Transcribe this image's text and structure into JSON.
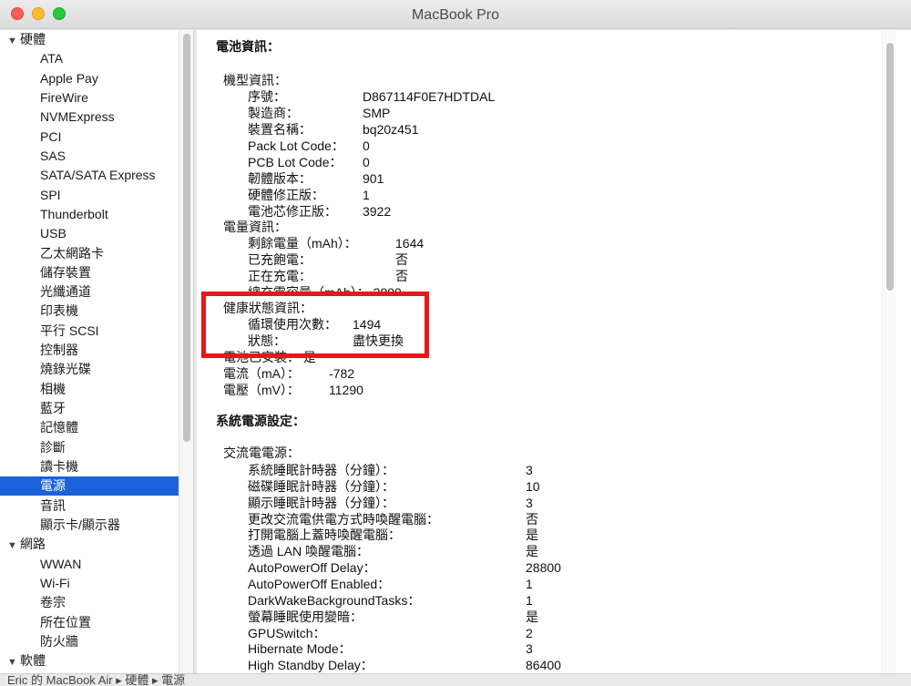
{
  "window": {
    "title": "MacBook Pro"
  },
  "sidebar": {
    "items": [
      {
        "type": "category",
        "label": "硬體"
      },
      {
        "type": "child",
        "label": "ATA"
      },
      {
        "type": "child",
        "label": "Apple Pay"
      },
      {
        "type": "child",
        "label": "FireWire"
      },
      {
        "type": "child",
        "label": "NVMExpress"
      },
      {
        "type": "child",
        "label": "PCI"
      },
      {
        "type": "child",
        "label": "SAS"
      },
      {
        "type": "child",
        "label": "SATA/SATA Express"
      },
      {
        "type": "child",
        "label": "SPI"
      },
      {
        "type": "child",
        "label": "Thunderbolt"
      },
      {
        "type": "child",
        "label": "USB"
      },
      {
        "type": "child",
        "label": "乙太網路卡"
      },
      {
        "type": "child",
        "label": "儲存裝置"
      },
      {
        "type": "child",
        "label": "光纖通道"
      },
      {
        "type": "child",
        "label": "印表機"
      },
      {
        "type": "child",
        "label": "平行 SCSI"
      },
      {
        "type": "child",
        "label": "控制器"
      },
      {
        "type": "child",
        "label": "燒錄光碟"
      },
      {
        "type": "child",
        "label": "相機"
      },
      {
        "type": "child",
        "label": "藍牙"
      },
      {
        "type": "child",
        "label": "記憶體"
      },
      {
        "type": "child",
        "label": "診斷"
      },
      {
        "type": "child",
        "label": "讀卡機"
      },
      {
        "type": "child",
        "label": "電源",
        "selected": true
      },
      {
        "type": "child",
        "label": "音訊"
      },
      {
        "type": "child",
        "label": "顯示卡/顯示器"
      },
      {
        "type": "category",
        "label": "網路"
      },
      {
        "type": "child",
        "label": "WWAN"
      },
      {
        "type": "child",
        "label": "Wi-Fi"
      },
      {
        "type": "child",
        "label": "卷宗"
      },
      {
        "type": "child",
        "label": "所在位置"
      },
      {
        "type": "child",
        "label": "防火牆"
      },
      {
        "type": "category",
        "label": "軟體"
      }
    ]
  },
  "content": {
    "battery_header": "電池資訊：",
    "model_info": "機型資訊：",
    "serial_label": "序號：",
    "serial_value": "D867114F0E7HDTDAL",
    "manufacturer_label": "製造商：",
    "manufacturer_value": "SMP",
    "device_label": "裝置名稱：",
    "device_value": "bq20z451",
    "packlot_label": "Pack Lot Code：",
    "packlot_value": "0",
    "pcblot_label": "PCB Lot Code：",
    "pcblot_value": "0",
    "firmware_label": "韌體版本：",
    "firmware_value": "901",
    "hwrev_label": "硬體修正版：",
    "hwrev_value": "1",
    "cellrev_label": "電池芯修正版：",
    "cellrev_value": "3922",
    "charge_info": "電量資訊：",
    "remaining_label": "剩餘電量（mAh）：",
    "remaining_value": "1644",
    "fully_charged_label": "已充飽電：",
    "fully_charged_value": "否",
    "charging_label": "正在充電：",
    "charging_value": "否",
    "full_capacity_partial": "總充電容量（mAh）： 2890",
    "health_info": "健康狀態資訊：",
    "cycle_label": "循環使用次數：",
    "cycle_value": "1494",
    "condition_label": "狀態：",
    "condition_value": "盡快更換",
    "installed_partial": "電池已安裝： 是",
    "amperage_label": "電流（mA）：",
    "amperage_value": "-782",
    "voltage_label": "電壓（mV）：",
    "voltage_value": "11290",
    "power_settings_header": "系統電源設定：",
    "ac_power": "交流電電源：",
    "settings": [
      {
        "label": "系統睡眠計時器（分鐘）：",
        "value": "3"
      },
      {
        "label": "磁碟睡眠計時器（分鐘）：",
        "value": "10"
      },
      {
        "label": "顯示睡眠計時器（分鐘）：",
        "value": "3"
      },
      {
        "label": "更改交流電供電方式時喚醒電腦：",
        "value": "否"
      },
      {
        "label": "打開電腦上蓋時喚醒電腦：",
        "value": "是"
      },
      {
        "label": "透過 LAN 喚醒電腦：",
        "value": "是"
      },
      {
        "label": "AutoPowerOff Delay：",
        "value": "28800"
      },
      {
        "label": "AutoPowerOff Enabled：",
        "value": "1"
      },
      {
        "label": "DarkWakeBackgroundTasks：",
        "value": "1"
      },
      {
        "label": "螢幕睡眠使用變暗：",
        "value": "是"
      },
      {
        "label": "GPUSwitch：",
        "value": "2"
      },
      {
        "label": "Hibernate Mode：",
        "value": "3"
      },
      {
        "label": "High Standby Delay：",
        "value": "86400"
      }
    ]
  },
  "statusbar": {
    "path": "Eric 的 MacBook Air ▸ 硬體 ▸ 電源"
  }
}
